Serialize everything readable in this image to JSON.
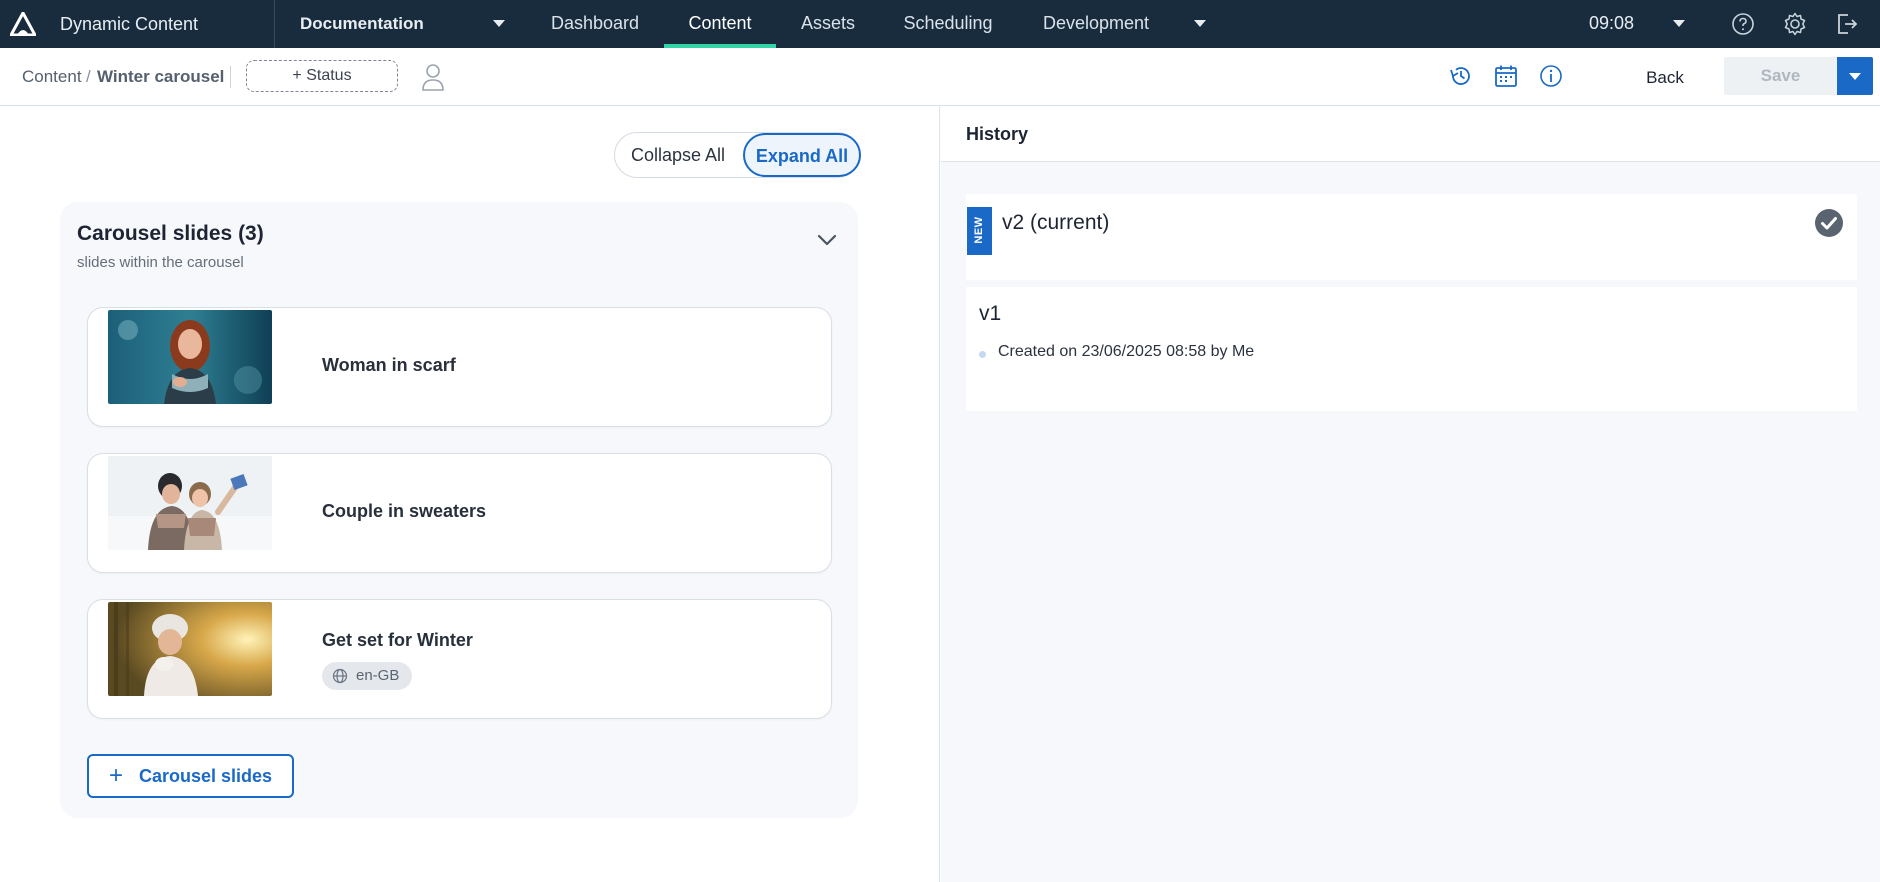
{
  "topbar": {
    "app_name": "Dynamic Content",
    "hub_name": "Documentation",
    "nav": [
      "Dashboard",
      "Content",
      "Assets",
      "Scheduling",
      "Development"
    ],
    "active_nav": "Content",
    "time": "09:08",
    "icons": [
      "logo-icon",
      "help-icon",
      "gear-icon",
      "logout-icon"
    ]
  },
  "subbar": {
    "breadcrumb_root": "Content",
    "breadcrumb_sep": "/",
    "breadcrumb_current": "Winter carousel",
    "status_label": "+ Status",
    "back_label": "Back",
    "save_label": "Save",
    "icons": [
      "history-icon",
      "calendar-icon",
      "info-icon",
      "person-icon"
    ]
  },
  "editor": {
    "collapse_label": "Collapse All",
    "expand_label": "Expand All",
    "panel_title": "Carousel slides (3)",
    "panel_subtitle": "slides within the carousel",
    "slides": [
      {
        "title": "Woman in scarf"
      },
      {
        "title": "Couple in sweaters"
      },
      {
        "title": "Get set for Winter",
        "locale": "en-GB"
      }
    ],
    "add_label": "Carousel slides"
  },
  "history": {
    "title": "History",
    "versions": [
      {
        "tag": "NEW",
        "label": "v2 (current)"
      },
      {
        "label": "v1",
        "meta": "Created on 23/06/2025 08:58 by Me"
      }
    ]
  },
  "colors": {
    "topbar_bg": "#182c3e",
    "active_underline": "#34d4a7",
    "accent": "#1a69c7",
    "check": "#5a6470"
  }
}
